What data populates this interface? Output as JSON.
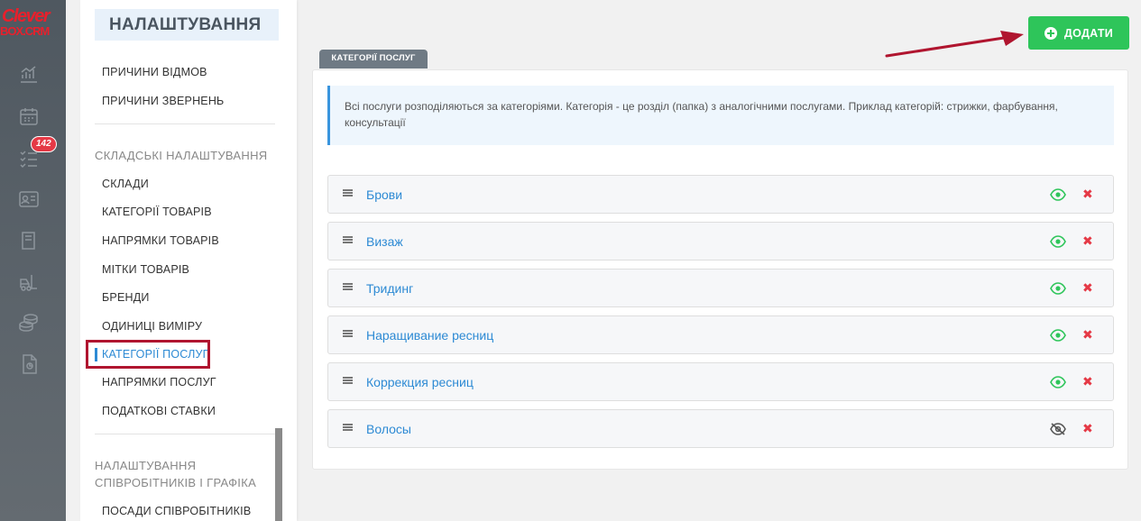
{
  "logo": {
    "line1": "Clever",
    "line2": "BOX.CRM"
  },
  "rail": {
    "badge": "142",
    "icons": [
      "analytics-icon",
      "calendar-icon",
      "tasks-icon",
      "contacts-icon",
      "book-icon",
      "forklift-icon",
      "coins-icon",
      "document-icon"
    ]
  },
  "panel": {
    "title": "НАЛАШТУВАННЯ",
    "items_top": [
      "ПРИЧИНИ ВІДМОВ",
      "ПРИЧИНИ ЗВЕРНЕНЬ"
    ],
    "section_warehouse": "СКЛАДСЬКІ НАЛАШТУВАННЯ",
    "items_warehouse": [
      "СКЛАДИ",
      "КАТЕГОРІЇ ТОВАРІВ",
      "НАПРЯМКИ ТОВАРІВ",
      "МІТКИ ТОВАРІВ",
      "БРЕНДИ",
      "ОДИНИЦІ ВИМІРУ",
      "КАТЕГОРІЇ ПОСЛУГ",
      "НАПРЯМКИ ПОСЛУГ",
      "ПОДАТКОВІ СТАВКИ"
    ],
    "section_staff_line1": "НАЛАШТУВАННЯ",
    "section_staff_line2": "СПІВРОБІТНИКІВ І ГРАФІКА",
    "items_staff": [
      "ПОСАДИ СПІВРОБІТНИКІВ"
    ]
  },
  "main": {
    "tab_label": "КАТЕГОРІЇ ПОСЛУГ",
    "add_button": "ДОДАТИ",
    "info_text": "Всі послуги розподіляються за категоріями. Категорія - це розділ (папка) з аналогічними послугами. Приклад категорій: стрижки, фарбування, консультації",
    "categories": [
      {
        "name": "Брови",
        "visible": true
      },
      {
        "name": "Визаж",
        "visible": true
      },
      {
        "name": "Тридинг",
        "visible": true
      },
      {
        "name": "Наращивание ресниц",
        "visible": true
      },
      {
        "name": "Коррекция ресниц",
        "visible": true
      },
      {
        "name": "Волосы",
        "visible": false
      }
    ],
    "delete_glyph": "✖"
  },
  "colors": {
    "accent": "#2d8ad4",
    "add_button": "#2ec55a",
    "delete": "#e53946",
    "highlight": "#b0152f",
    "annotation_arrow": "#b0152f"
  }
}
